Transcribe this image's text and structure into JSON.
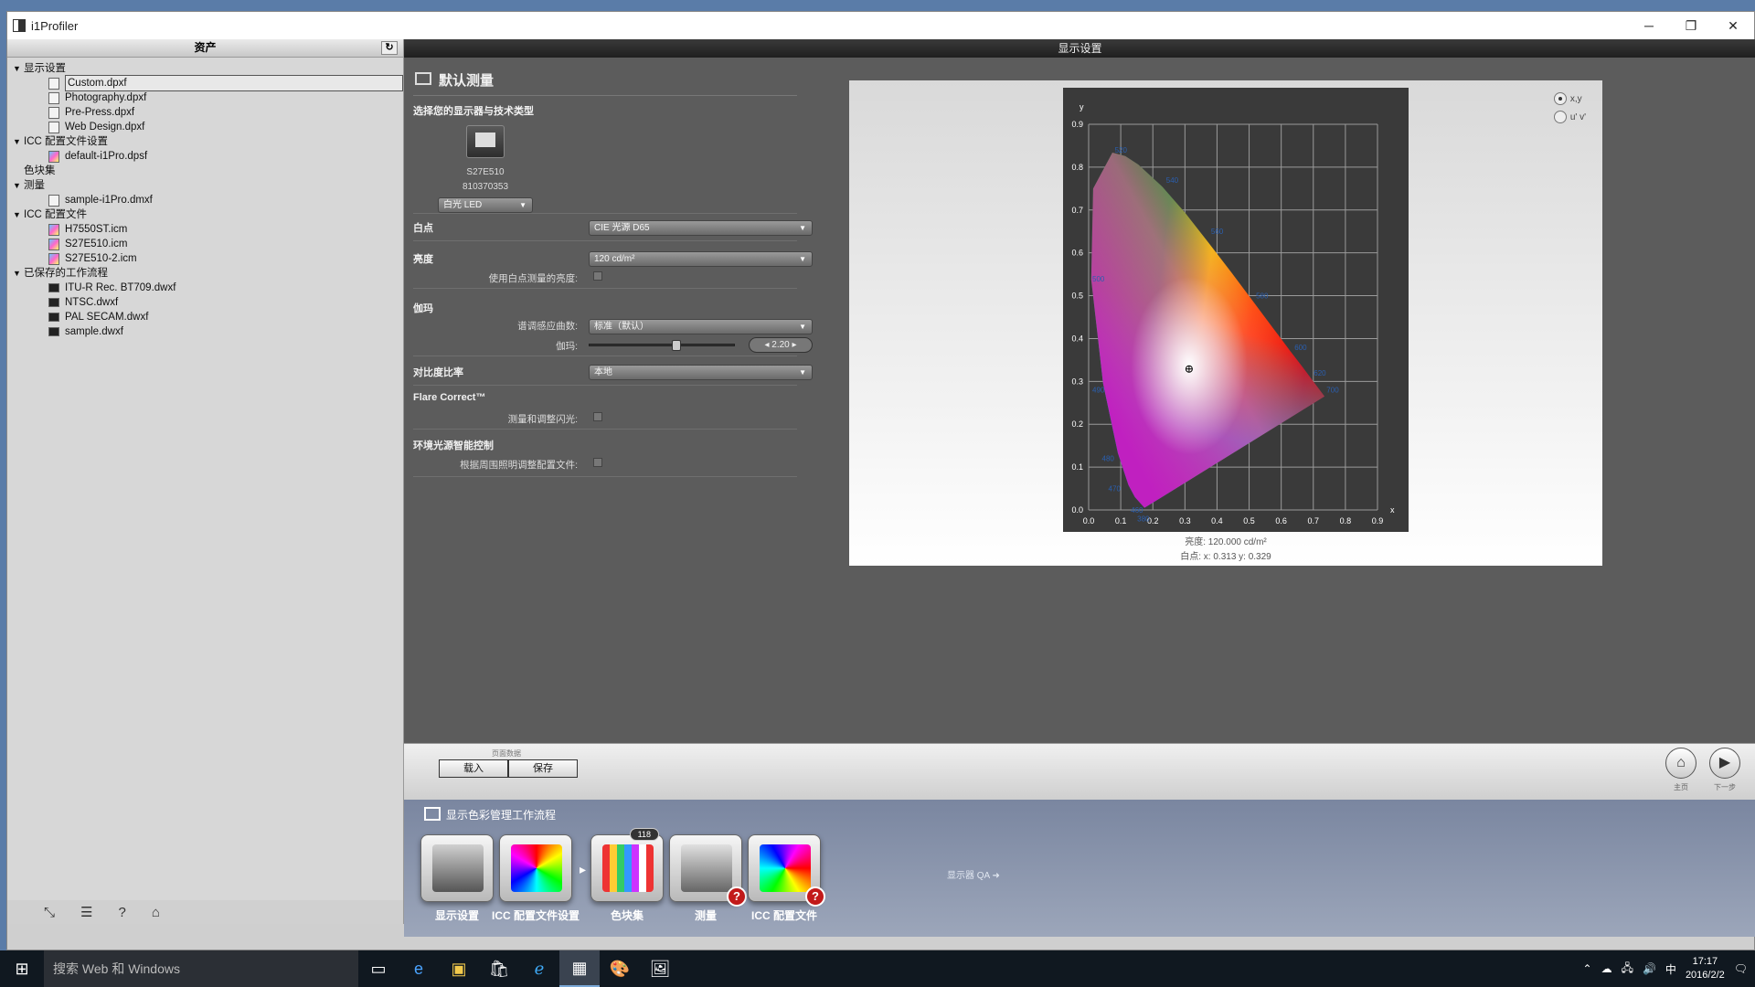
{
  "window": {
    "title": "i1Profiler",
    "min": "─",
    "restore": "❐",
    "close": "✕"
  },
  "assets": {
    "header": "资产",
    "refresh": "↻",
    "tree": [
      {
        "level": 0,
        "type": "group",
        "label": "显示设置"
      },
      {
        "level": 1,
        "type": "file",
        "label": "Custom.dpxf",
        "selected": true
      },
      {
        "level": 1,
        "type": "file",
        "label": "Photography.dpxf"
      },
      {
        "level": 1,
        "type": "file",
        "label": "Pre-Press.dpxf"
      },
      {
        "level": 1,
        "type": "file",
        "label": "Web Design.dpxf"
      },
      {
        "level": 0,
        "type": "group",
        "label": "ICC 配置文件设置"
      },
      {
        "level": 1,
        "type": "icc",
        "label": "default-i1Pro.dpsf"
      },
      {
        "level": 0,
        "type": "plain",
        "label": "色块集"
      },
      {
        "level": 0,
        "type": "group",
        "label": "测量"
      },
      {
        "level": 1,
        "type": "file",
        "label": "sample-i1Pro.dmxf"
      },
      {
        "level": 0,
        "type": "group",
        "label": "ICC 配置文件"
      },
      {
        "level": 1,
        "type": "icc",
        "label": "H7550ST.icm"
      },
      {
        "level": 1,
        "type": "icc",
        "label": "S27E510.icm"
      },
      {
        "level": 1,
        "type": "icc",
        "label": "S27E510-2.icm"
      },
      {
        "level": 0,
        "type": "group",
        "label": "已保存的工作流程"
      },
      {
        "level": 1,
        "type": "wf",
        "label": "ITU-R Rec. BT709.dwxf"
      },
      {
        "level": 1,
        "type": "wf",
        "label": "NTSC.dwxf"
      },
      {
        "level": 1,
        "type": "wf",
        "label": "PAL SECAM.dwxf"
      },
      {
        "level": 1,
        "type": "wf",
        "label": "sample.dwxf"
      }
    ],
    "footer_icons": [
      "expand-icon",
      "list-icon",
      "help-icon",
      "home-icon"
    ]
  },
  "panel": {
    "header": "显示设置",
    "section_title": "默认测量",
    "device_prompt": "选择您的显示器与技术类型",
    "device_name": "S27E510",
    "device_serial": "810370353",
    "tech_type": "白光 LED",
    "white_point_label": "白点",
    "white_point_value": "CIE 光源 D65",
    "luminance_label": "亮度",
    "luminance_value": "120 cd/m²",
    "use_native_label": "使用白点测量的亮度:",
    "gamma_label": "伽玛",
    "tone_label": "谱调感应曲数:",
    "tone_value": "标准（默认）",
    "gamma_sub_label": "伽玛:",
    "gamma_value": "2.20",
    "gamma_fraction": 0.6,
    "contrast_label": "对比度比率",
    "contrast_value": "本地",
    "flare_title": "Flare Correct™",
    "flare_label": "测量和调整闪光:",
    "ambient_title": "环境光源智能控制",
    "ambient_label": "根据周围照明调整配置文件:"
  },
  "chart": {
    "radio_xy": "x,y",
    "radio_uv": "u' v'",
    "luminance_caption": "亮度:  120.000 cd/m²",
    "whitepoint_caption": "白点:  x: 0.313  y: 0.329"
  },
  "chart_data": {
    "type": "scatter",
    "title": "",
    "xlabel": "x",
    "ylabel": "y",
    "xlim": [
      0.0,
      0.9
    ],
    "ylim": [
      0.0,
      0.9
    ],
    "x_ticks": [
      "0.0",
      "0.1",
      "0.2",
      "0.3",
      "0.4",
      "0.5",
      "0.6",
      "0.7",
      "0.8",
      "0.9"
    ],
    "y_ticks": [
      "0.0",
      "0.1",
      "0.2",
      "0.3",
      "0.4",
      "0.5",
      "0.6",
      "0.7",
      "0.8",
      "0.9"
    ],
    "grid": true,
    "white_point": {
      "x": 0.313,
      "y": 0.329
    },
    "locus_labels": [
      {
        "label": "520",
        "x": 0.07,
        "y": 0.84
      },
      {
        "label": "540",
        "x": 0.23,
        "y": 0.77
      },
      {
        "label": "560",
        "x": 0.37,
        "y": 0.65
      },
      {
        "label": "580",
        "x": 0.51,
        "y": 0.5
      },
      {
        "label": "600",
        "x": 0.63,
        "y": 0.38
      },
      {
        "label": "620",
        "x": 0.69,
        "y": 0.32
      },
      {
        "label": "700",
        "x": 0.73,
        "y": 0.28
      },
      {
        "label": "500",
        "x": 0.0,
        "y": 0.54
      },
      {
        "label": "490",
        "x": 0.0,
        "y": 0.28
      },
      {
        "label": "480",
        "x": 0.03,
        "y": 0.12
      },
      {
        "label": "470",
        "x": 0.05,
        "y": 0.05
      },
      {
        "label": "460",
        "x": 0.12,
        "y": 0.0
      },
      {
        "label": "380",
        "x": 0.14,
        "y": -0.02
      }
    ]
  },
  "bottom": {
    "file_label": "页面数据",
    "load": "载入",
    "save": "保存",
    "home_label": "主页",
    "next_label": "下一步"
  },
  "workflow": {
    "title": "显示色彩管理工作流程",
    "steps": [
      {
        "label": "显示设置"
      },
      {
        "label": "ICC 配置文件设置"
      },
      {
        "label": "色块集",
        "badge": "118"
      },
      {
        "label": "测量",
        "warn": true
      },
      {
        "label": "ICC 配置文件",
        "warn": true
      }
    ],
    "qa": "显示器 QA"
  },
  "taskbar": {
    "search": "搜索 Web 和 Windows",
    "time": "17:17",
    "date": "2016/2/2",
    "ime": "中"
  }
}
